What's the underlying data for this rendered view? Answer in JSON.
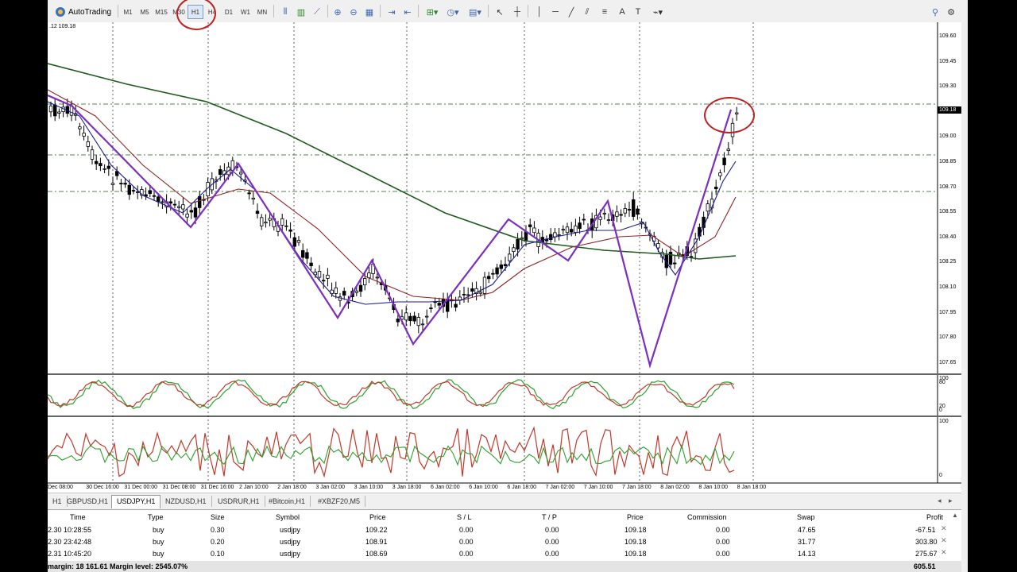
{
  "toolbar": {
    "autotrading_label": "AutoTrading",
    "timeframes": [
      "M1",
      "M5",
      "M15",
      "M30",
      "H1",
      "H4",
      "D1",
      "W1",
      "MN"
    ],
    "active_timeframe": "H1"
  },
  "chart": {
    "symbol_info": ".12 109.18",
    "current_price": "109.18",
    "price_axis": [
      "109.60",
      "109.45",
      "109.30",
      "109.15",
      "109.00",
      "108.85",
      "108.70",
      "108.55",
      "108.40",
      "108.25",
      "108.10",
      "107.95",
      "107.80",
      "107.65"
    ],
    "stoch_axis": [
      "100",
      "80",
      "20",
      "0"
    ],
    "rsi_axis": [
      "100",
      "0"
    ],
    "time_axis": [
      "Dec 08:00",
      "30 Dec 16:00",
      "31 Dec 00:00",
      "31 Dec 08:00",
      "31 Dec 16:00",
      "2 Jan 10:00",
      "2 Jan 18:00",
      "3 Jan 02:00",
      "3 Jan 10:00",
      "3 Jan 18:00",
      "6 Jan 02:00",
      "6 Jan 10:00",
      "6 Jan 18:00",
      "7 Jan 02:00",
      "7 Jan 10:00",
      "7 Jan 18:00",
      "8 Jan 02:00",
      "8 Jan 10:00",
      "8 Jan 18:00"
    ],
    "colors": {
      "zigzag": "#7b2fbe",
      "ma_fast": "#1a1a8c",
      "ma_mid": "#8b2323",
      "ma_slow": "#1e5a1e",
      "stoch_main": "#2ca02c",
      "stoch_signal": "#c0392b",
      "annotation": "#b22222"
    }
  },
  "tabs": {
    "items": [
      "H1",
      "GBPUSD,H1",
      "USDJPY,H1",
      "NZDUSD,H1",
      "USDRUR,H1",
      "#Bitcoin,H1",
      "#XBZF20,M5"
    ],
    "active": "USDJPY,H1"
  },
  "trades": {
    "headers": [
      "Time",
      "Type",
      "Size",
      "Symbol",
      "Price",
      "S / L",
      "T / P",
      "Price",
      "Commission",
      "Swap",
      "Profit"
    ],
    "rows": [
      {
        "time": "2.30 10:28:55",
        "type": "buy",
        "size": "0.30",
        "symbol": "usdjpy",
        "price": "109.22",
        "sl": "0.00",
        "tp": "0.00",
        "cur": "109.18",
        "commission": "0.00",
        "swap": "47.65",
        "profit": "-67.51"
      },
      {
        "time": "2.30 23:42:48",
        "type": "buy",
        "size": "0.20",
        "symbol": "usdjpy",
        "price": "108.91",
        "sl": "0.00",
        "tp": "0.00",
        "cur": "109.18",
        "commission": "0.00",
        "swap": "31.77",
        "profit": "303.80"
      },
      {
        "time": "2.31 10:45:20",
        "type": "buy",
        "size": "0.10",
        "symbol": "usdjpy",
        "price": "108.69",
        "sl": "0.00",
        "tp": "0.00",
        "cur": "109.18",
        "commission": "0.00",
        "swap": "14.13",
        "profit": "275.67"
      }
    ],
    "summary_left": "margin: 18 161.61  Margin level: 2545.07%",
    "summary_profit": "605.51"
  }
}
